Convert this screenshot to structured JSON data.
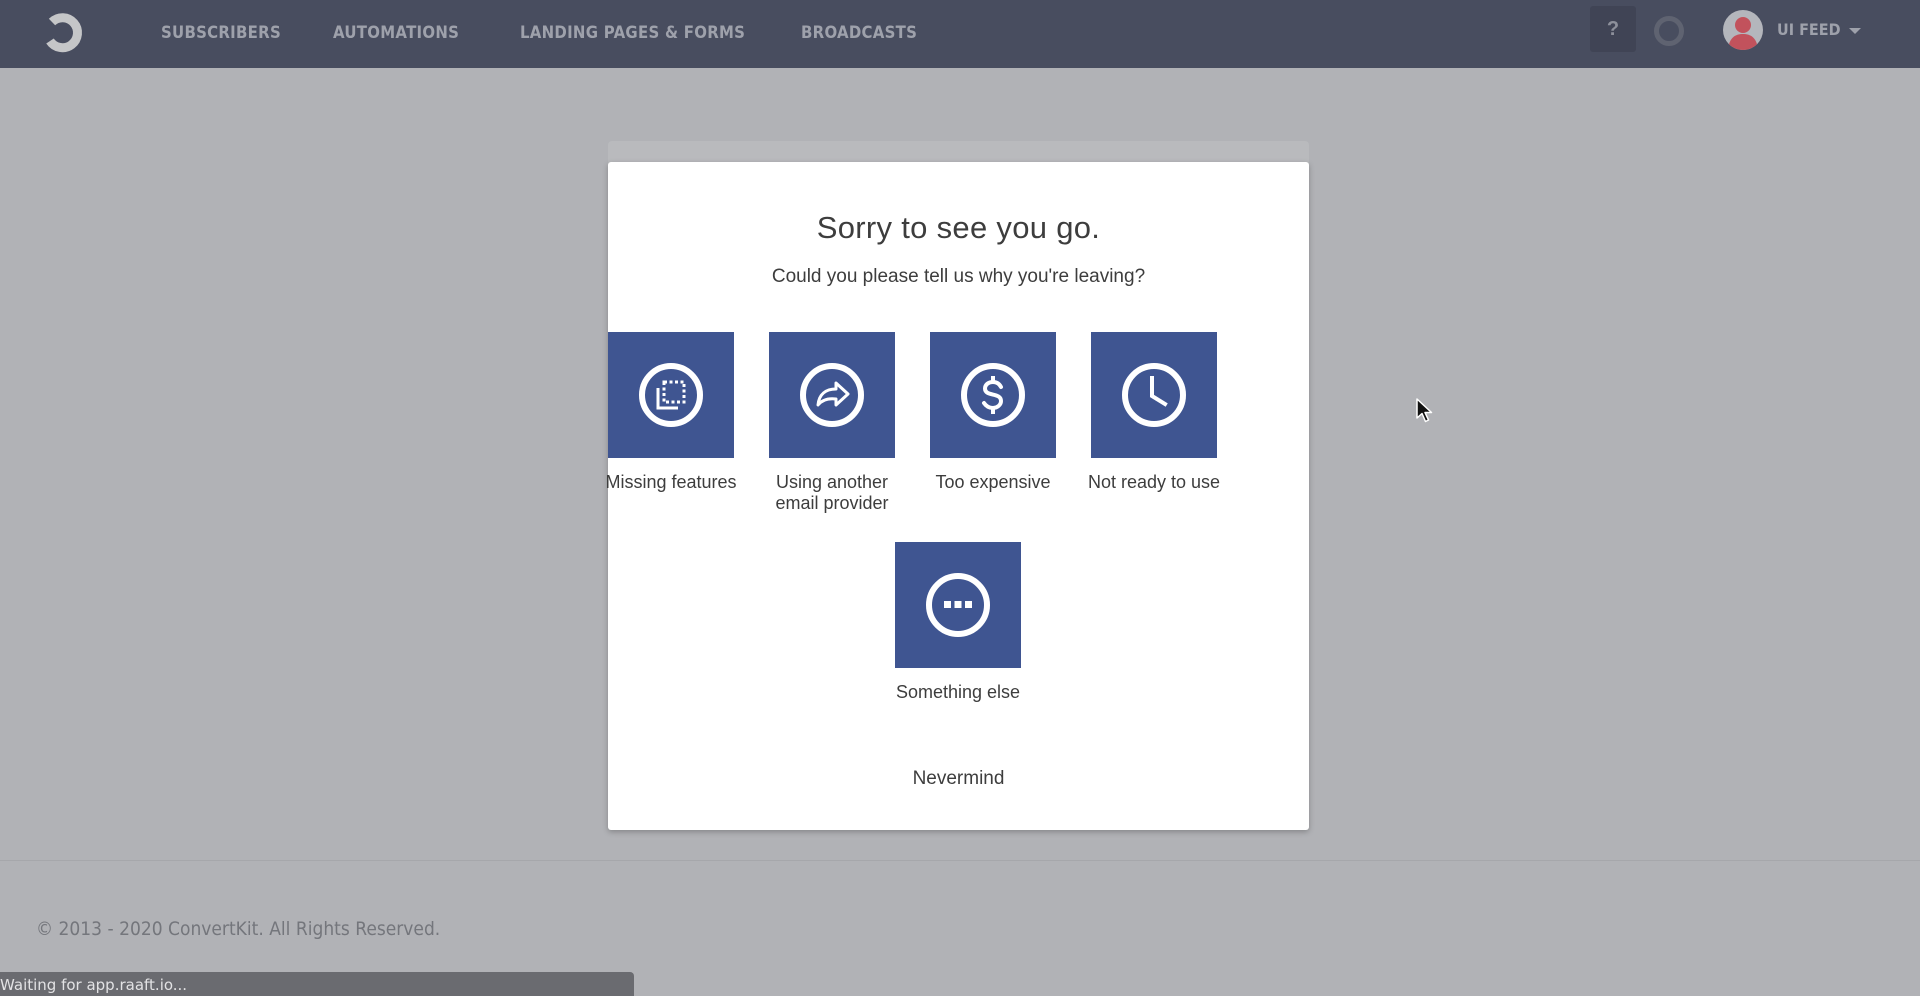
{
  "navbar": {
    "logo": "convertkit-logo-icon",
    "items": [
      {
        "label": "SUBSCRIBERS"
      },
      {
        "label": "AUTOMATIONS"
      },
      {
        "label": "LANDING PAGES & FORMS"
      },
      {
        "label": "BROADCASTS"
      }
    ],
    "help_label": "?",
    "user_name": "UI FEED"
  },
  "modal": {
    "title": "Sorry to see you go.",
    "subtitle": "Could you please tell us why you're leaving?",
    "tile_color": "#3f5591",
    "options": [
      {
        "label": "Missing features",
        "icon": "missing-features-icon"
      },
      {
        "label": "Using another email provider",
        "icon": "share-arrow-icon"
      },
      {
        "label": "Too expensive",
        "icon": "dollar-icon"
      },
      {
        "label": "Not ready to use",
        "icon": "clock-icon"
      },
      {
        "label": "Something else",
        "icon": "ellipsis-icon"
      }
    ],
    "nevermind_label": "Nevermind"
  },
  "footer": {
    "copyright": "© 2013 - 2020 ConvertKit. All Rights Reserved."
  },
  "status_bar": {
    "text": "Waiting for app.raaft.io..."
  }
}
